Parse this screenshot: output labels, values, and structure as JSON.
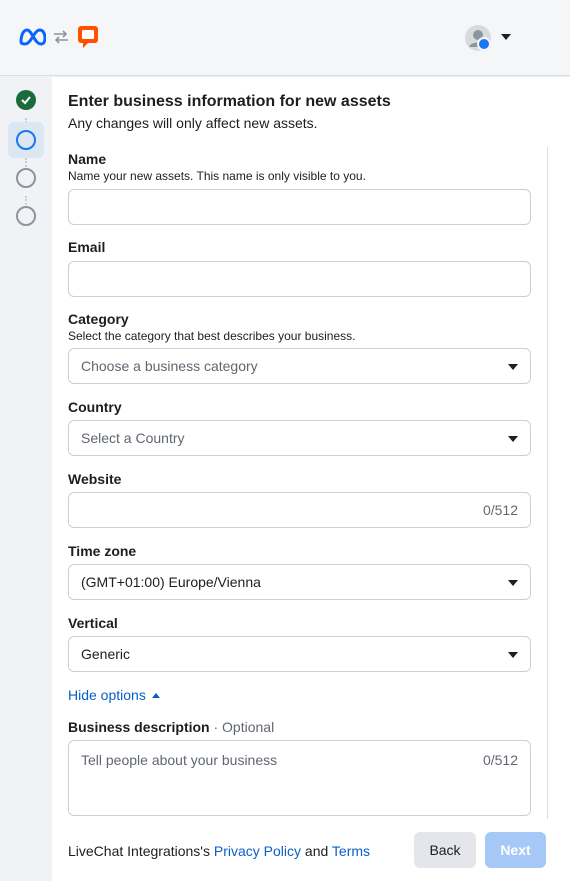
{
  "header": {
    "title": "Enter business information for new assets",
    "subtitle": "Any changes will only affect new assets."
  },
  "form": {
    "name": {
      "label": "Name",
      "help": "Name your new assets. This name is only visible to you.",
      "value": ""
    },
    "email": {
      "label": "Email",
      "value": ""
    },
    "category": {
      "label": "Category",
      "help": "Select the category that best describes your business.",
      "placeholder": "Choose a business category"
    },
    "country": {
      "label": "Country",
      "placeholder": "Select a Country"
    },
    "website": {
      "label": "Website",
      "counter": "0/512"
    },
    "timezone": {
      "label": "Time zone",
      "value": "(GMT+01:00) Europe/Vienna"
    },
    "vertical": {
      "label": "Vertical",
      "value": "Generic"
    },
    "toggle_label": "Hide options",
    "description": {
      "label": "Business description",
      "optional": "· Optional",
      "placeholder": "Tell people about your business",
      "counter": "0/512"
    }
  },
  "footer": {
    "prefix": "LiveChat Integrations's",
    "privacy_link": "Privacy Policy",
    "and": "and",
    "terms_link": "Terms",
    "back_label": "Back",
    "next_label": "Next"
  },
  "stepper": {
    "current_step": 2,
    "total_steps": 4
  },
  "colors": {
    "accent": "#1877f2",
    "link": "#0a5fc7",
    "next_disabled": "#a5c8f7",
    "done_step": "#1b6b3a"
  }
}
